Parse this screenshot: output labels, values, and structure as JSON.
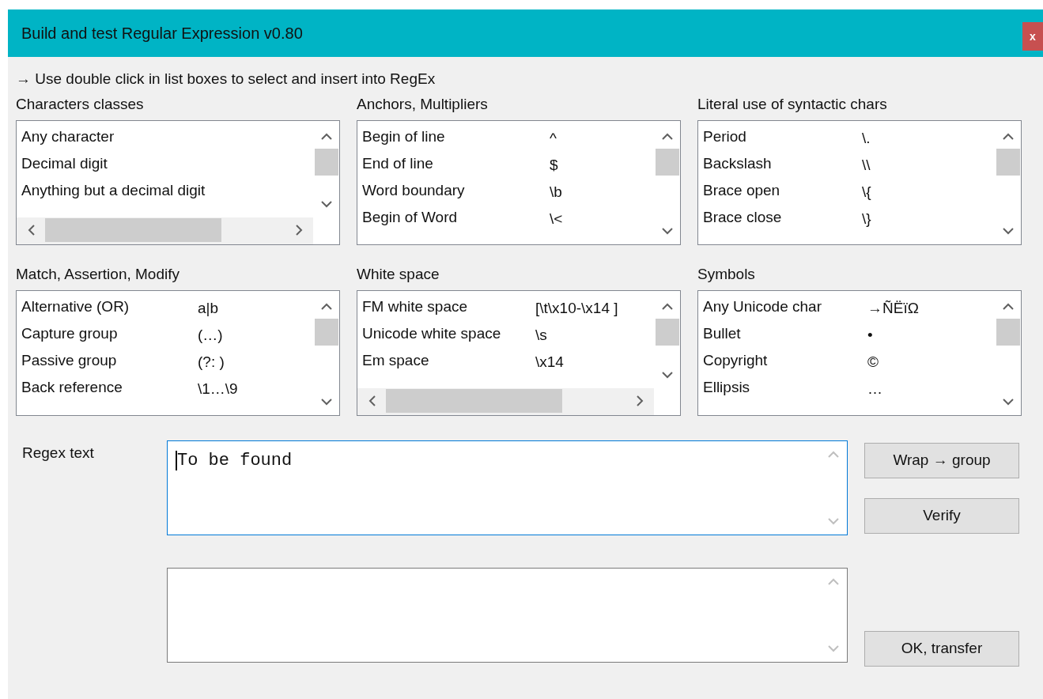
{
  "window": {
    "title": "Build and test Regular Expression v0.80",
    "close": "x"
  },
  "hint": "→ Use double click in list boxes to select and insert into RegEx",
  "lists": [
    {
      "label": "Characters classes",
      "horizontal_scrollbar": true,
      "rows": [
        {
          "name": "Any character"
        },
        {
          "name": "Decimal digit"
        },
        {
          "name": "Anything but a decimal digit"
        }
      ]
    },
    {
      "label": "Anchors, Multipliers",
      "horizontal_scrollbar": false,
      "rows": [
        {
          "name": "Begin of line",
          "value": "^"
        },
        {
          "name": "End of line",
          "value": "$"
        },
        {
          "name": "Word boundary",
          "value": "\\b"
        },
        {
          "name": "Begin of Word",
          "value": "\\<"
        }
      ]
    },
    {
      "label": "Literal use of syntactic chars",
      "horizontal_scrollbar": false,
      "rows": [
        {
          "name": "Period",
          "value": "\\."
        },
        {
          "name": "Backslash",
          "value": "\\\\"
        },
        {
          "name": "Brace open",
          "value": "\\{"
        },
        {
          "name": "Brace close",
          "value": "\\}"
        }
      ]
    },
    {
      "label": "Match, Assertion, Modify",
      "horizontal_scrollbar": false,
      "rows": [
        {
          "name": "Alternative (OR)",
          "value": "a|b"
        },
        {
          "name": "Capture group",
          "value": "(…)"
        },
        {
          "name": "Passive group",
          "value": "(?: )"
        },
        {
          "name": "Back reference",
          "value": "\\1…\\9"
        }
      ]
    },
    {
      "label": "White space",
      "horizontal_scrollbar": true,
      "rows": [
        {
          "name": "FM white space",
          "value": "[\\t\\x10-\\x14 ]"
        },
        {
          "name": "Unicode white space",
          "value": "\\s"
        },
        {
          "name": "Em space",
          "value": "\\x14"
        }
      ]
    },
    {
      "label": "Symbols",
      "horizontal_scrollbar": false,
      "rows": [
        {
          "name": "Any Unicode char",
          "value": "→ÑËïΩ"
        },
        {
          "name": "Bullet",
          "value": "•"
        },
        {
          "name": "Copyright",
          "value": "©"
        },
        {
          "name": "Ellipsis",
          "value": "…"
        }
      ]
    }
  ],
  "regex": {
    "label": "Regex text",
    "value": "To be found",
    "focused": true
  },
  "result": {
    "focused": false
  },
  "buttons": [
    {
      "label": "Wrap → group"
    },
    {
      "label": "Verify"
    },
    {
      "label": "OK, transfer"
    }
  ]
}
